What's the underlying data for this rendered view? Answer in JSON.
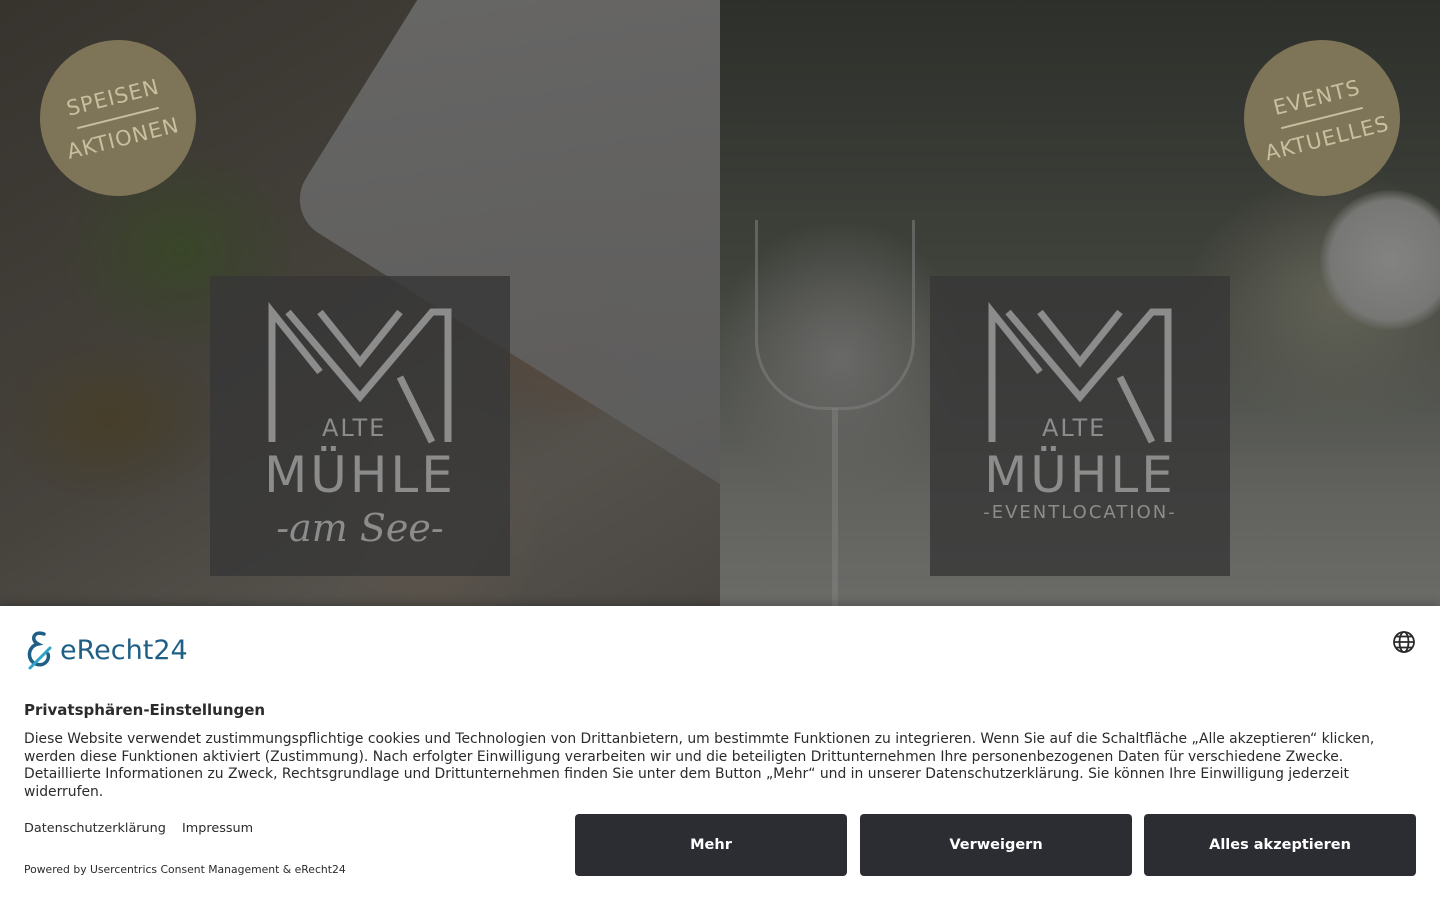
{
  "hero": {
    "left": {
      "badge_top": "SPEISEN",
      "badge_bottom": "AKTIONEN",
      "logo_alte": "ALTE",
      "logo_muehle": "MÜHLE",
      "logo_sub": "-am See-"
    },
    "right": {
      "badge_top": "EVENTS",
      "badge_bottom": "AKTUELLES",
      "logo_alte": "ALTE",
      "logo_muehle": "MÜHLE",
      "logo_sub": "-EVENTLOCATION-"
    }
  },
  "consent": {
    "brand": "eRecht24",
    "language_icon": "globe-icon",
    "title": "Privatsphären-Einstellungen",
    "text": "Diese Website verwendet zustimmungspflichtige cookies und Technologien von Drittanbietern, um bestimmte Funktionen zu integrieren. Wenn Sie auf die Schaltfläche „Alle akzeptieren“ klicken, werden diese Funktionen aktiviert (Zustimmung). Nach erfolgter Einwilligung verarbeiten wir und die beteiligten Drittunternehmen Ihre personenbezogenen Daten für verschiedene Zwecke. Detaillierte Informationen zu Zweck, Rechtsgrundlage und Drittunternehmen finden Sie unter dem Button „Mehr“ und in unserer Datenschutzerklärung. Sie können Ihre Einwilligung jederzeit widerrufen.",
    "links": {
      "privacy": "Datenschutzerklärung",
      "imprint": "Impressum"
    },
    "powered_by": "Powered by Usercentrics Consent Management & eRecht24",
    "buttons": {
      "more": "Mehr",
      "deny": "Verweigern",
      "accept": "Alles akzeptieren"
    },
    "colors": {
      "button_bg": "#2b2d33",
      "brand_blue": "#1f5f86",
      "badge_gold": "#7e7457"
    }
  }
}
